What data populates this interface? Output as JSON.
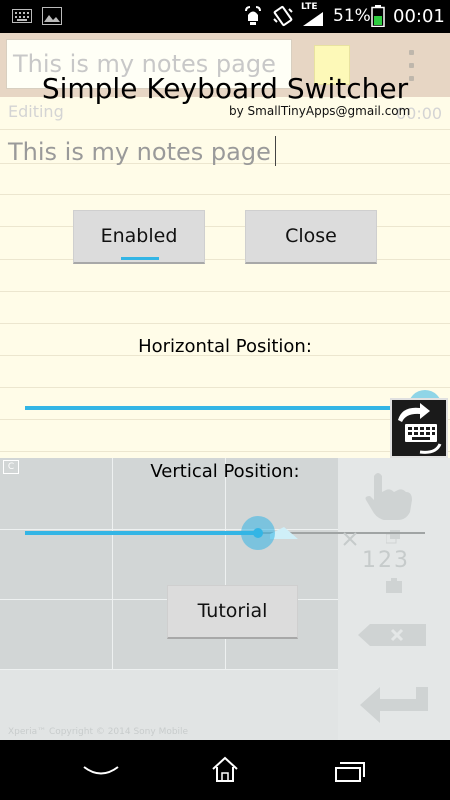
{
  "status_bar": {
    "network_type": "LTE",
    "battery_percent": "51%",
    "time": "00:01",
    "icons": [
      "keyboard-icon",
      "image-icon",
      "alarm-icon",
      "vibrate-icon",
      "signal-icon",
      "battery-icon"
    ]
  },
  "notes_app": {
    "title_value": "This is my notes page",
    "status_label": "Editing",
    "time_label": "00:00",
    "body_text": "This is my notes page",
    "swatch_color": "#fdf9b8"
  },
  "overlay": {
    "title": "Simple Keyboard Switcher",
    "byline": "by SmallTinyApps@gmail.com",
    "enabled_button": "Enabled",
    "close_button": "Close",
    "horizontal_label": "Horizontal Position:",
    "horizontal_value": 1.0,
    "vertical_label": "Vertical Position:",
    "vertical_value": 0.52,
    "tutorial_button": "Tutorial",
    "accent_color": "#33b5e5"
  },
  "keyboard": {
    "badge": "C",
    "numbers_key": "123",
    "footer_text": "Xperia™ Copyright © 2014 Sony Mobile"
  },
  "nav_bar": {
    "icons": [
      "hide-keyboard-icon",
      "home-icon",
      "recent-apps-icon"
    ]
  }
}
